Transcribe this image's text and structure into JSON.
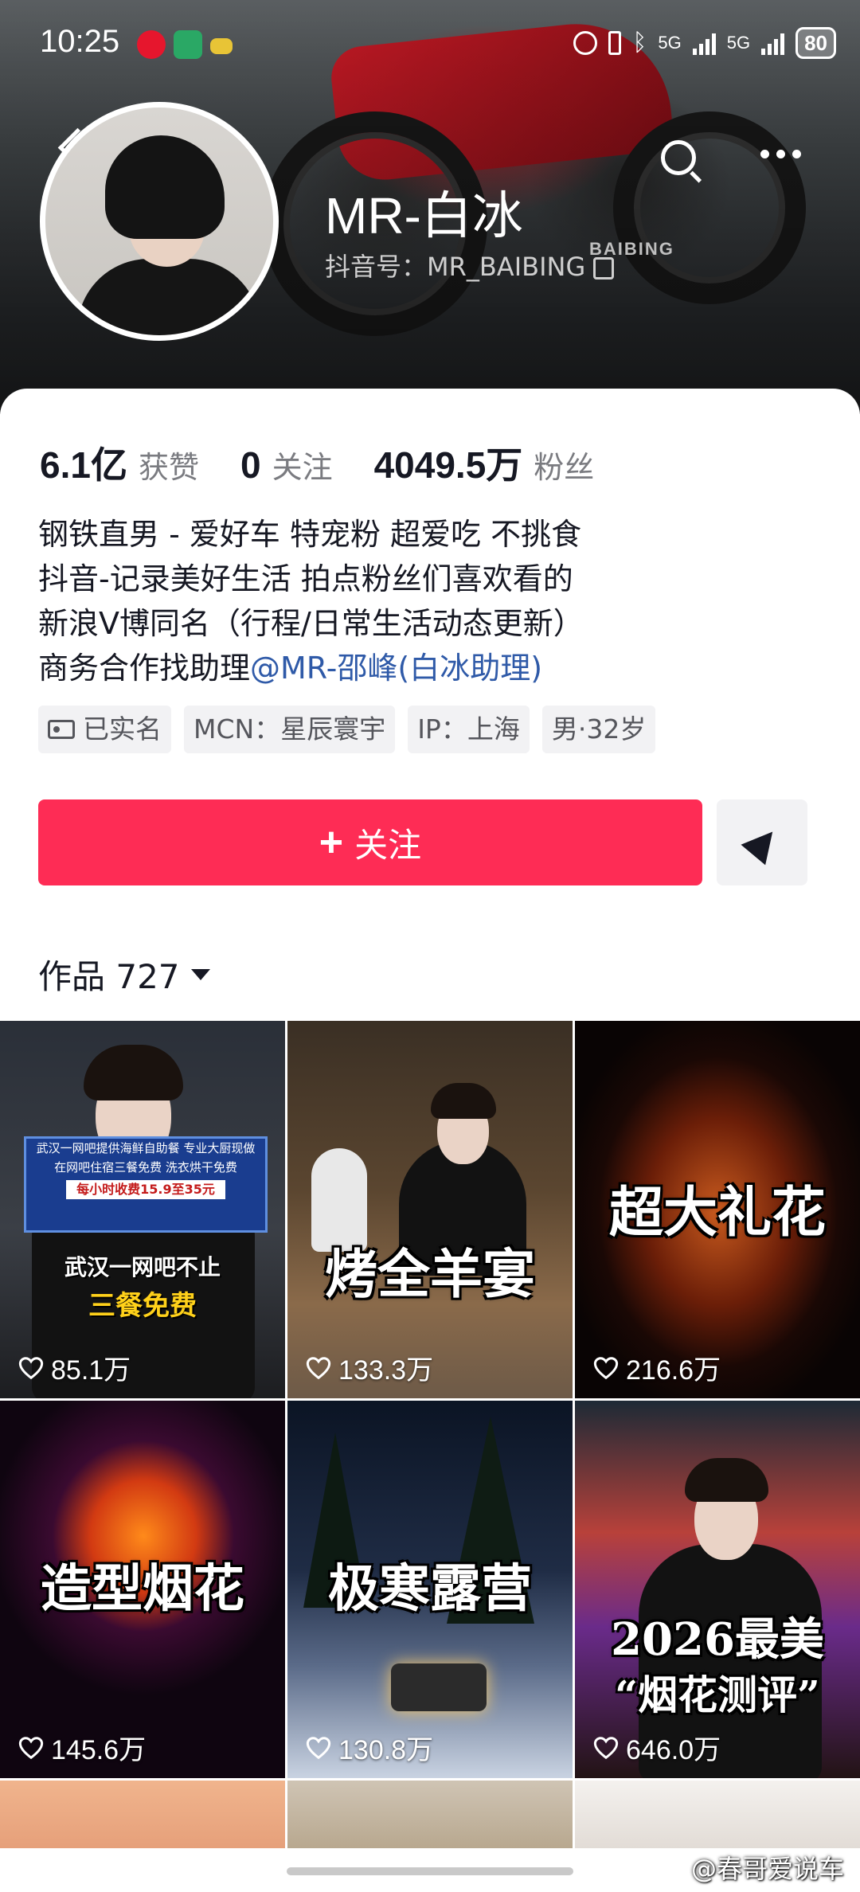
{
  "status_bar": {
    "time": "10:25",
    "network_label": "5G",
    "network_label_2": "5G",
    "battery": "80"
  },
  "header": {
    "nickname_latin": "MR-",
    "nickname_cn": "白冰",
    "douyin_id": "抖音号：MR_BAIBING",
    "banner_logo": "BAIBING"
  },
  "stats": [
    {
      "value": "6.1亿",
      "label": "获赞"
    },
    {
      "value": "0",
      "label": "关注"
    },
    {
      "value": "4049.5万",
      "label": "粉丝"
    }
  ],
  "bio": {
    "line1": "钢铁直男 - 爱好车 特宠粉 超爱吃 不挑食",
    "line2": "抖音-记录美好生活 拍点粉丝们喜欢看的",
    "line3": "新浪V博同名（行程/日常生活动态更新）",
    "line4_prefix": "商务合作找助理",
    "line4_link": "@MR-邵峰(白冰助理)"
  },
  "tags": {
    "verified": "已实名",
    "mcn": "MCN：星辰寰宇",
    "ip": "IP：上海",
    "gender_age": "男·32岁"
  },
  "actions": {
    "follow_label": "关注",
    "follow_plus": "+"
  },
  "works_tab": {
    "label": "作品 727"
  },
  "videos": [
    {
      "likes": "85.1万",
      "board_title": "武汉一网吧提供海鲜自助餐 专业大厨现做",
      "board_line": "在网吧住宿三餐免费 洗衣烘干免费",
      "board_price": "每小时收费15.9至35元",
      "caption_1": "武汉一网吧不止",
      "caption_2": "三餐免费"
    },
    {
      "likes": "133.3万",
      "caption": "烤全羊宴"
    },
    {
      "likes": "216.6万",
      "caption": "超大礼花"
    },
    {
      "likes": "145.6万",
      "caption": "造型烟花"
    },
    {
      "likes": "130.8万",
      "caption": "极寒露营"
    },
    {
      "likes": "646.0万",
      "caption_1": "2026最美",
      "caption_2": "“烟花测评”"
    }
  ],
  "watermark": "@春哥爱说车",
  "colors": {
    "accent": "#fe2c55",
    "link": "#2f5aa8",
    "tag_bg": "#f2f2f4",
    "muted": "#7a7b80"
  }
}
